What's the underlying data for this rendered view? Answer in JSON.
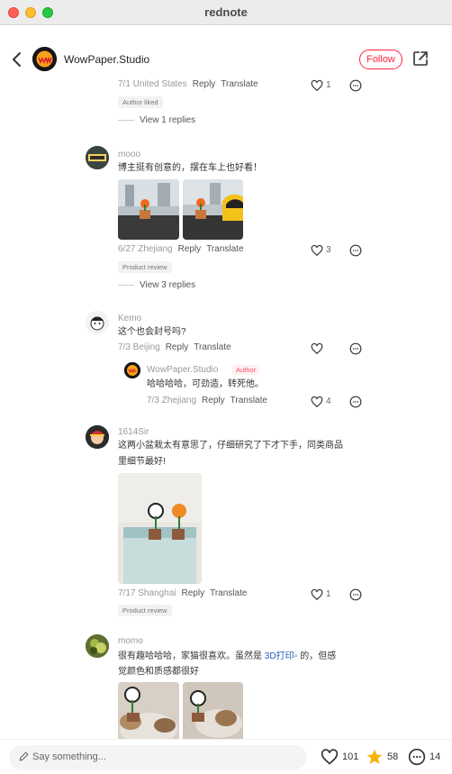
{
  "window": {
    "title": "rednote"
  },
  "header": {
    "author_name": "WowPaper.Studio",
    "follow_label": "Follow"
  },
  "actions": {
    "reply": "Reply",
    "translate": "Translate"
  },
  "comments": [
    {
      "meta": "7/1 United States",
      "likes": "1",
      "tag": "Author liked",
      "view_replies": "View 1 replies"
    },
    {
      "user": "mooo",
      "text": "博主挺有创意的，摆在车上也好看！",
      "meta": "6/27 Zhejiang",
      "likes": "3",
      "tag": "Product review",
      "view_replies": "View 3 replies"
    },
    {
      "user": "Kemo",
      "text": "这个也会封号吗?",
      "meta": "7/3 Beijing",
      "likes": "",
      "reply": {
        "user": "WowPaper.Studio",
        "author_tag": "Author",
        "text": "哈哈哈哈，可劲造，转死他。",
        "meta": "7/3 Zhejiang",
        "likes": "4"
      }
    },
    {
      "user": "1614Sir",
      "text_line1": "这两小盆栽太有意思了，仔细研究了下才下手，同类商品",
      "text_line2": "里细节最好!",
      "meta": "7/17 Shanghai",
      "likes": "1",
      "tag": "Product review"
    },
    {
      "user": "momo",
      "text_before": "很有趣哈哈哈，家猫很喜欢。虽然是 ",
      "link": "3D打印",
      "text_after": " 的，但感",
      "text_line2": "觉颜色和质感都很好"
    }
  ],
  "bottom": {
    "placeholder": "Say something...",
    "likes": "101",
    "stars": "58",
    "comments": "14"
  },
  "colors": {
    "accent": "#ff2442",
    "link": "#1d5fb8",
    "star": "#f5b400"
  },
  "icons": [
    "back-icon",
    "share-icon",
    "heart-icon",
    "comment-icon",
    "pen-icon",
    "star-icon"
  ]
}
